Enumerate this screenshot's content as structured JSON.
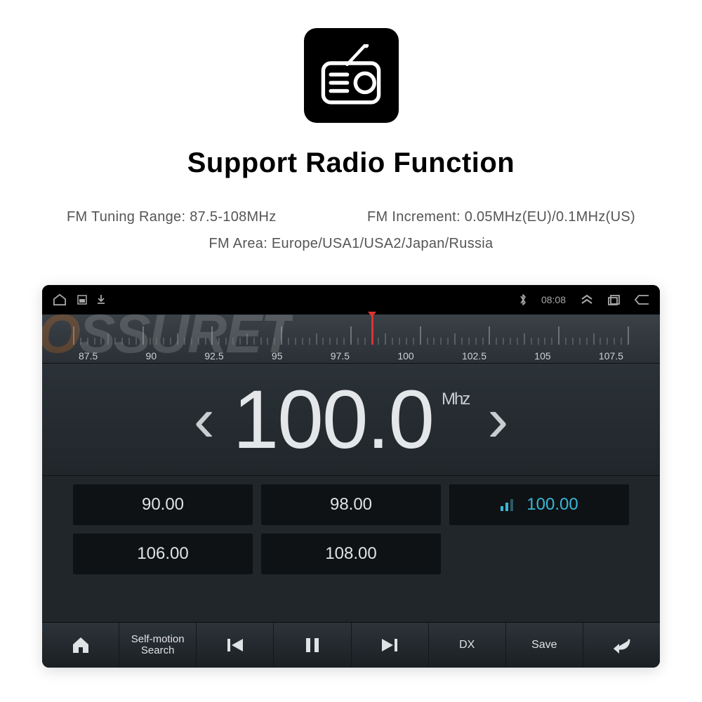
{
  "title": "Support Radio Function",
  "specs": {
    "tuning_range": "FM Tuning Range: 87.5-108MHz",
    "increment": "FM Increment: 0.05MHz(EU)/0.1MHz(US)",
    "area": "FM Area: Europe/USA1/USA2/Japan/Russia"
  },
  "statusbar": {
    "time": "08:08"
  },
  "ruler_labels": [
    "87.5",
    "90",
    "92.5",
    "95",
    "97.5",
    "100",
    "102.5",
    "105",
    "107.5"
  ],
  "frequency": {
    "value": "100.0",
    "unit": "Mhz"
  },
  "presets": {
    "row1": [
      {
        "label": "90.00",
        "active": false
      },
      {
        "label": "98.00",
        "active": false
      },
      {
        "label": "100.00",
        "active": true
      }
    ],
    "row2": [
      {
        "label": "106.00",
        "active": false
      },
      {
        "label": "108.00",
        "active": false
      }
    ]
  },
  "bottombar": {
    "search": "Self-motion Search",
    "dx": "DX",
    "save": "Save"
  },
  "watermark": "OSSURET"
}
